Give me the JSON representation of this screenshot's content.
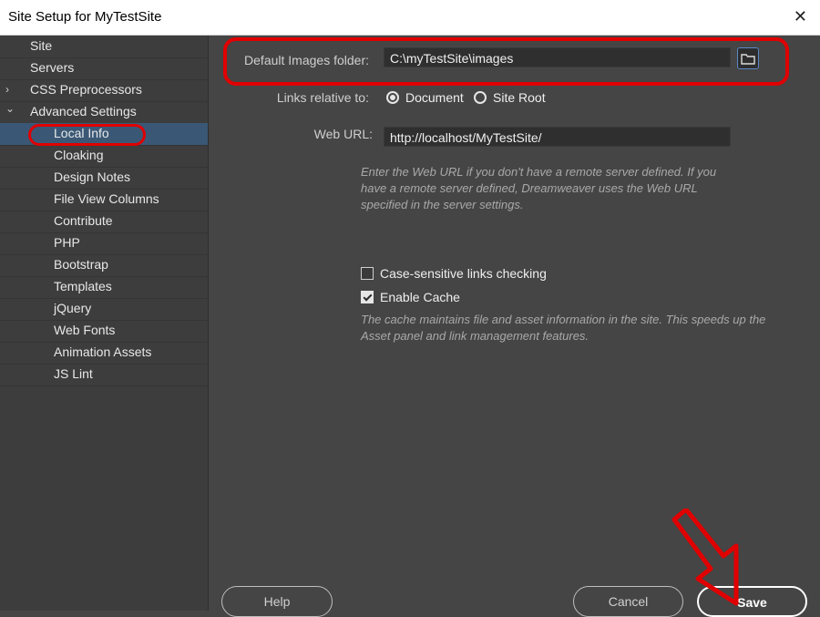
{
  "window": {
    "title": "Site Setup for MyTestSite",
    "close_glyph": "✕"
  },
  "sidebar": {
    "items": [
      {
        "label": "Site"
      },
      {
        "label": "Servers"
      },
      {
        "label": "CSS Preprocessors",
        "chevron": "›"
      },
      {
        "label": "Advanced Settings",
        "chevron": "⌄"
      },
      {
        "label": "Local Info"
      },
      {
        "label": "Cloaking"
      },
      {
        "label": "Design Notes"
      },
      {
        "label": "File View Columns"
      },
      {
        "label": "Contribute"
      },
      {
        "label": "PHP"
      },
      {
        "label": "Bootstrap"
      },
      {
        "label": "Templates"
      },
      {
        "label": "jQuery"
      },
      {
        "label": "Web Fonts"
      },
      {
        "label": "Animation Assets"
      },
      {
        "label": "JS Lint"
      }
    ]
  },
  "form": {
    "images_folder_label": "Default Images folder:",
    "images_folder_value": "C:\\myTestSite\\images",
    "links_relative_label": "Links relative to:",
    "option_document": "Document",
    "option_site_root": "Site Root",
    "web_url_label": "Web URL:",
    "web_url_value": "http://localhost/MyTestSite/",
    "web_url_help": "Enter the Web URL if you don't have a remote server defined. If you have a remote server defined, Dreamweaver uses the Web URL specified in the server settings.",
    "case_sensitive_label": "Case-sensitive links checking",
    "case_sensitive_checked": false,
    "enable_cache_label": "Enable Cache",
    "enable_cache_checked": true,
    "cache_help": "The cache maintains file and asset information in the site. This speeds up the Asset panel and link management features."
  },
  "buttons": {
    "help": "Help",
    "cancel": "Cancel",
    "save": "Save"
  },
  "colors": {
    "annotation_red": "#e00000",
    "selection_blue": "#3a5876"
  }
}
